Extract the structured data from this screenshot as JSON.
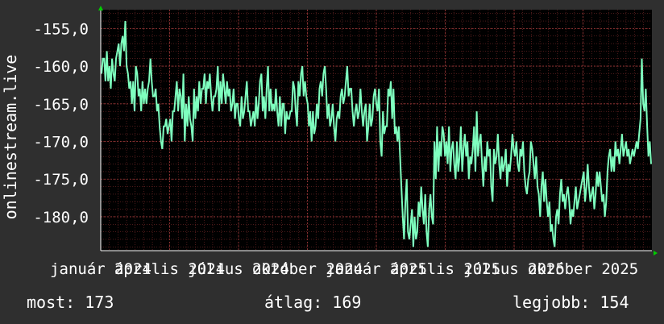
{
  "chart_data": {
    "type": "line",
    "ylabel": "onlinestream.live",
    "ylim": [
      -184.5,
      -152.5
    ],
    "yticks": [
      -155,
      -160,
      -165,
      -170,
      -175,
      -180
    ],
    "ytick_labels": [
      "-155,0",
      "-160,0",
      "-165,0",
      "-170,0",
      "-175,0",
      "-180,0"
    ],
    "xticks": [
      {
        "label": "január 2024",
        "x": 0.0
      },
      {
        "label": "április 2024",
        "x": 0.125
      },
      {
        "label": "július 2024",
        "x": 0.25
      },
      {
        "label": "október 2024",
        "x": 0.375
      },
      {
        "label": "január 2025",
        "x": 0.5
      },
      {
        "label": "április 2025",
        "x": 0.625
      },
      {
        "label": "július 2025",
        "x": 0.75
      },
      {
        "label": "október 2025",
        "x": 0.875
      }
    ],
    "grid": true,
    "background": "#000000",
    "grid_color": "#7a2a2a",
    "line_color": "#7fffbf",
    "series": [
      {
        "values": [
          -161,
          -159,
          -159,
          -162,
          -158,
          -162,
          -160,
          -163,
          -159,
          -161,
          -162,
          -159,
          -158,
          -157,
          -160,
          -157,
          -156,
          -158,
          -154,
          -160,
          -161,
          -163,
          -162,
          -165,
          -162,
          -166,
          -160,
          -161,
          -164,
          -163,
          -166,
          -162,
          -165,
          -163,
          -165,
          -163,
          -162,
          -159,
          -162,
          -164,
          -164,
          -163,
          -166,
          -165,
          -168,
          -170,
          -171,
          -168,
          -168,
          -167,
          -169,
          -168,
          -167,
          -170,
          -166,
          -166,
          -164,
          -162,
          -166,
          -163,
          -164,
          -167,
          -161,
          -170,
          -165,
          -168,
          -164,
          -167,
          -168,
          -170,
          -163,
          -167,
          -164,
          -166,
          -162,
          -165,
          -163,
          -163,
          -161,
          -165,
          -162,
          -163,
          -161,
          -164,
          -166,
          -164,
          -164,
          -163,
          -160,
          -166,
          -162,
          -165,
          -161,
          -163,
          -165,
          -162,
          -164,
          -163,
          -166,
          -165,
          -163,
          -167,
          -165,
          -165,
          -167,
          -168,
          -164,
          -167,
          -166,
          -164,
          -162,
          -166,
          -166,
          -168,
          -167,
          -166,
          -168,
          -164,
          -167,
          -165,
          -162,
          -161,
          -166,
          -164,
          -167,
          -163,
          -160,
          -166,
          -163,
          -166,
          -165,
          -166,
          -163,
          -166,
          -168,
          -164,
          -168,
          -165,
          -165,
          -169,
          -166,
          -167,
          -167,
          -166,
          -166,
          -162,
          -163,
          -166,
          -168,
          -162,
          -164,
          -161,
          -160,
          -164,
          -162,
          -164,
          -165,
          -168,
          -166,
          -170,
          -166,
          -169,
          -168,
          -165,
          -167,
          -163,
          -162,
          -164,
          -161,
          -160,
          -163,
          -167,
          -165,
          -168,
          -167,
          -165,
          -168,
          -170,
          -167,
          -166,
          -167,
          -164,
          -163,
          -165,
          -164,
          -162,
          -160,
          -164,
          -163,
          -163,
          -166,
          -168,
          -166,
          -165,
          -167,
          -166,
          -163,
          -166,
          -168,
          -166,
          -165,
          -170,
          -168,
          -165,
          -168,
          -167,
          -164,
          -163,
          -165,
          -166,
          -163,
          -170,
          -172,
          -166,
          -169,
          -168,
          -168,
          -163,
          -164,
          -162,
          -167,
          -163,
          -169,
          -168,
          -170,
          -168,
          -172,
          -176,
          -180,
          -183,
          -178,
          -175,
          -182,
          -183,
          -181,
          -179,
          -184,
          -180,
          -183,
          -182,
          -178,
          -180,
          -176,
          -179,
          -181,
          -177,
          -182,
          -184,
          -179,
          -177,
          -180,
          -181,
          -170,
          -175,
          -168,
          -174,
          -170,
          -172,
          -168,
          -169,
          -172,
          -170,
          -173,
          -168,
          -174,
          -171,
          -170,
          -173,
          -175,
          -170,
          -174,
          -172,
          -168,
          -174,
          -171,
          -169,
          -172,
          -170,
          -175,
          -172,
          -173,
          -171,
          -168,
          -174,
          -166,
          -172,
          -170,
          -169,
          -173,
          -176,
          -172,
          -174,
          -170,
          -172,
          -171,
          -176,
          -178,
          -171,
          -173,
          -172,
          -169,
          -173,
          -175,
          -172,
          -174,
          -173,
          -171,
          -176,
          -173,
          -174,
          -172,
          -169,
          -171,
          -172,
          -170,
          -173,
          -174,
          -171,
          -172,
          -170,
          -174,
          -176,
          -177,
          -175,
          -174,
          -170,
          -171,
          -173,
          -175,
          -172,
          -176,
          -177,
          -180,
          -176,
          -174,
          -178,
          -175,
          -178,
          -180,
          -178,
          -182,
          -181,
          -183,
          -184,
          -180,
          -179,
          -181,
          -177,
          -175,
          -178,
          -177,
          -179,
          -177,
          -176,
          -178,
          -181,
          -179,
          -180,
          -178,
          -176,
          -179,
          -178,
          -177,
          -176,
          -175,
          -174,
          -178,
          -176,
          -173,
          -176,
          -178,
          -177,
          -176,
          -179,
          -177,
          -174,
          -176,
          -174,
          -176,
          -178,
          -177,
          -180,
          -178,
          -174,
          -172,
          -171,
          -174,
          -172,
          -174,
          -170,
          -172,
          -171,
          -173,
          -171,
          -169,
          -172,
          -171,
          -170,
          -172,
          -171,
          -173,
          -172,
          -171,
          -172,
          -171,
          -170,
          -171,
          -169,
          -167,
          -159,
          -165,
          -166,
          -163,
          -168,
          -172,
          -170,
          -173
        ]
      }
    ]
  },
  "stats": {
    "current": "most: 173",
    "average": "átlag: 169",
    "best": "legjobb: 154"
  }
}
